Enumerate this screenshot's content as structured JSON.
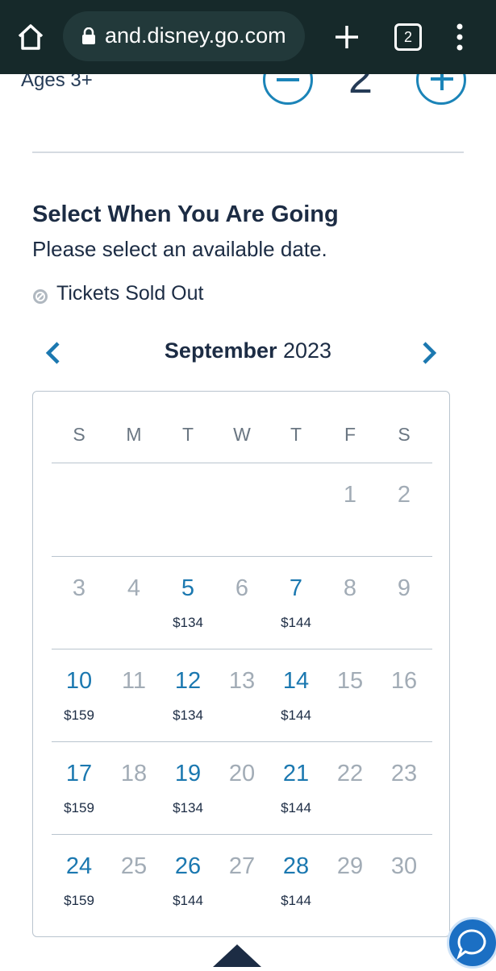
{
  "browser": {
    "url": "and.disney.go.com",
    "tab_count": "2",
    "icons": {
      "home": "home-icon",
      "lock": "lock-icon",
      "new_tab": "plus-icon",
      "tabs": "tabs-icon",
      "menu": "more-vert-icon"
    }
  },
  "guests": {
    "age_label": "Ages 3+",
    "count": "2"
  },
  "section": {
    "title": "Select When You Are Going",
    "subtitle": "Please select an available date.",
    "legend_sold_out": "Tickets Sold Out"
  },
  "calendar": {
    "month": "September",
    "year": "2023",
    "weekdays": [
      "S",
      "M",
      "T",
      "W",
      "T",
      "F",
      "S"
    ],
    "weeks": [
      [
        null,
        null,
        null,
        null,
        null,
        {
          "day": "1",
          "available": false
        },
        {
          "day": "2",
          "available": false
        }
      ],
      [
        {
          "day": "3",
          "available": false
        },
        {
          "day": "4",
          "available": false
        },
        {
          "day": "5",
          "available": true,
          "price": "$134"
        },
        {
          "day": "6",
          "available": false
        },
        {
          "day": "7",
          "available": true,
          "price": "$144"
        },
        {
          "day": "8",
          "available": false
        },
        {
          "day": "9",
          "available": false
        }
      ],
      [
        {
          "day": "10",
          "available": true,
          "price": "$159"
        },
        {
          "day": "11",
          "available": false
        },
        {
          "day": "12",
          "available": true,
          "price": "$134"
        },
        {
          "day": "13",
          "available": false
        },
        {
          "day": "14",
          "available": true,
          "price": "$144"
        },
        {
          "day": "15",
          "available": false
        },
        {
          "day": "16",
          "available": false
        }
      ],
      [
        {
          "day": "17",
          "available": true,
          "price": "$159"
        },
        {
          "day": "18",
          "available": false
        },
        {
          "day": "19",
          "available": true,
          "price": "$134"
        },
        {
          "day": "20",
          "available": false
        },
        {
          "day": "21",
          "available": true,
          "price": "$144"
        },
        {
          "day": "22",
          "available": false
        },
        {
          "day": "23",
          "available": false
        }
      ],
      [
        {
          "day": "24",
          "available": true,
          "price": "$159"
        },
        {
          "day": "25",
          "available": false
        },
        {
          "day": "26",
          "available": true,
          "price": "$144"
        },
        {
          "day": "27",
          "available": false
        },
        {
          "day": "28",
          "available": true,
          "price": "$144"
        },
        {
          "day": "29",
          "available": false
        },
        {
          "day": "30",
          "available": false
        }
      ]
    ]
  },
  "colors": {
    "browser_bar": "#16292a",
    "accent": "#1b78b0",
    "text_dark": "#1c2c44",
    "unavailable": "#a2acb6",
    "chat": "#1b6fc3"
  }
}
